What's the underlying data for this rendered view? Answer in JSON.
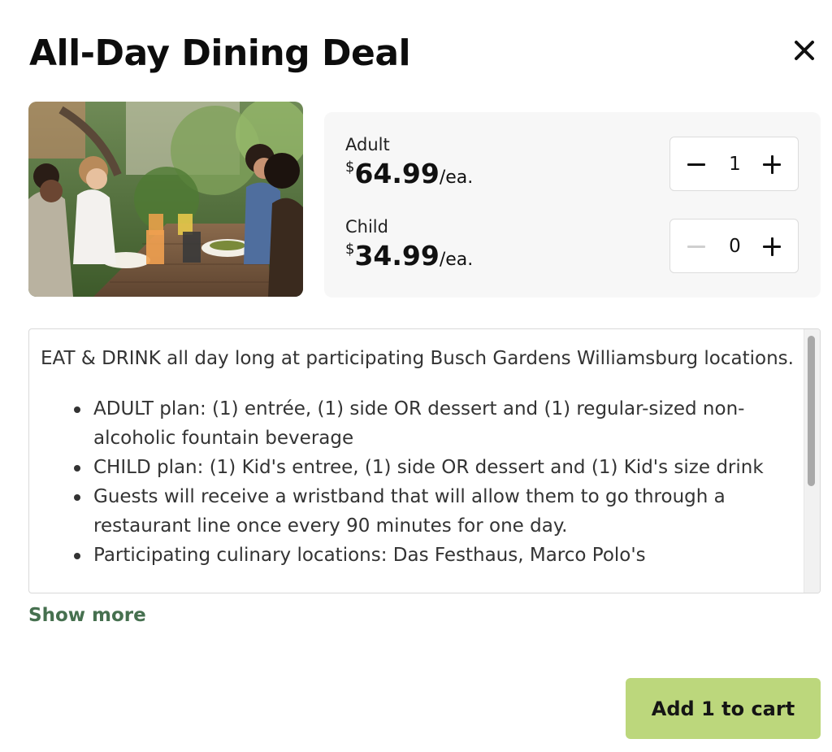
{
  "modal": {
    "title": "All-Day Dining Deal",
    "close_icon": "close-icon"
  },
  "image": {
    "alt": "Guests eating and drinking at an outdoor picnic table"
  },
  "tickets": [
    {
      "label": "Adult",
      "currency": "$",
      "price": "64.99",
      "unit": "/ea.",
      "quantity": "1",
      "minus_enabled": true
    },
    {
      "label": "Child",
      "currency": "$",
      "price": "34.99",
      "unit": "/ea.",
      "quantity": "0",
      "minus_enabled": false
    }
  ],
  "description": {
    "intro": "EAT & DRINK all day long at participating Busch Gardens Williamsburg locations.",
    "bullets": [
      "ADULT plan: (1) entrée, (1) side OR dessert and (1) regular-sized non- alcoholic fountain beverage",
      "CHILD plan: (1) Kid's entree, (1) side OR dessert and (1) Kid's size drink",
      "Guests will receive a wristband that will allow them to go through a restaurant line once every 90 minutes for one day.",
      "Participating culinary locations: Das Festhaus, Marco Polo's"
    ]
  },
  "show_more_label": "Show more",
  "cart_button_label": "Add 1 to cart",
  "colors": {
    "accent_green": "#bcd77c",
    "link_green": "#46704f",
    "panel_bg": "#f7f7f7"
  }
}
